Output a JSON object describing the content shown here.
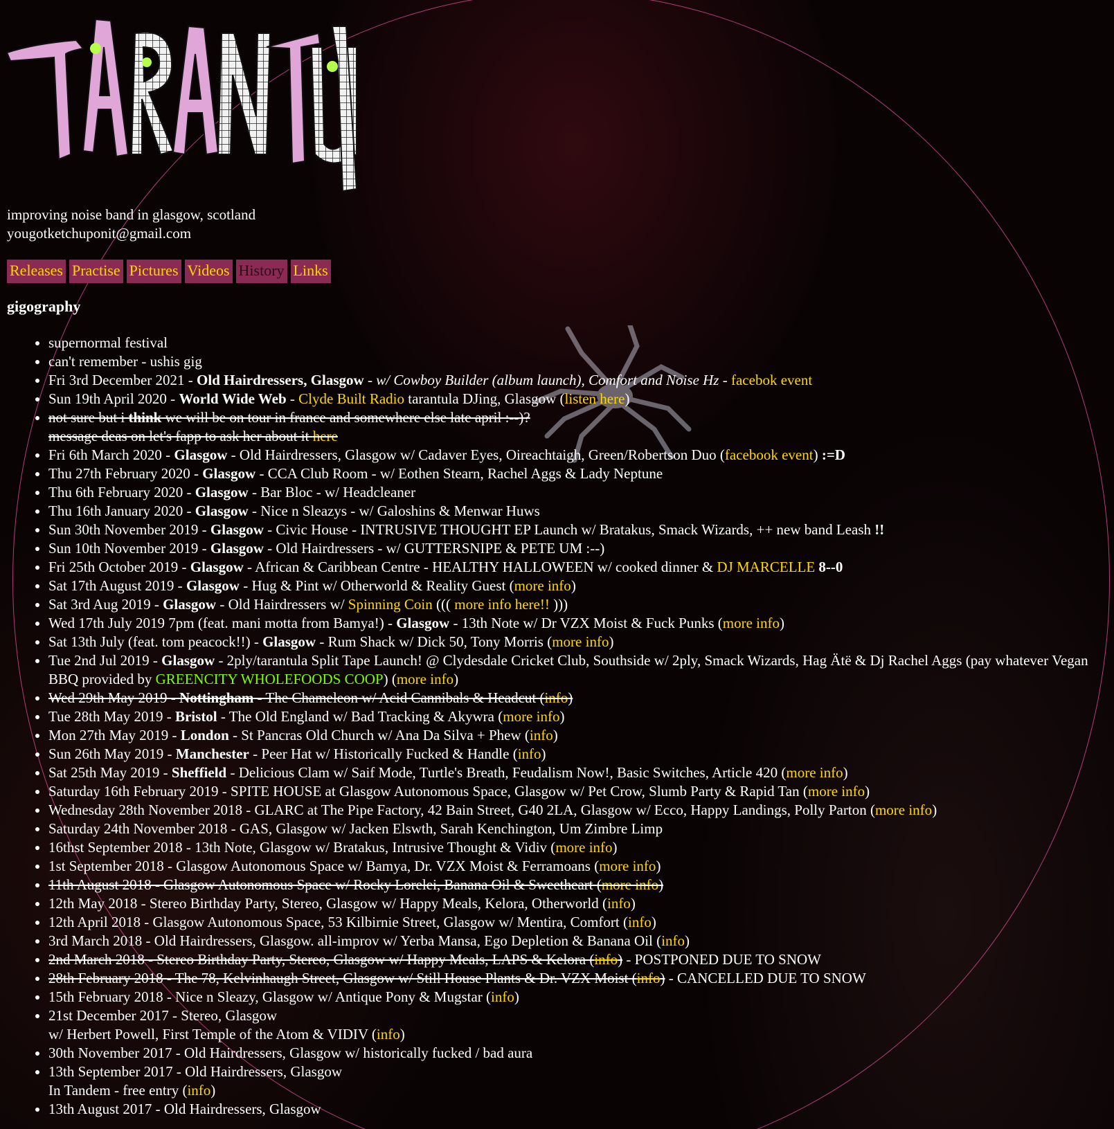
{
  "brand": {
    "logo_text": "TARANTULA",
    "tagline": "improving noise band in glasgow, scotland",
    "email": "yougotketchuponit@gmail.com"
  },
  "nav": [
    {
      "label": "Releases",
      "active": false
    },
    {
      "label": "Practise",
      "active": false
    },
    {
      "label": "Pictures",
      "active": false
    },
    {
      "label": "Videos",
      "active": false
    },
    {
      "label": "History",
      "active": true
    },
    {
      "label": "Links",
      "active": false
    }
  ],
  "section": {
    "title": "gigography"
  },
  "colors": {
    "link": "#ffd700",
    "link_green": "#7cfc00",
    "nav_bg": "#8b2a52",
    "circle": "#b43c78"
  },
  "gigs": [
    {
      "segments": [
        {
          "t": "supernormal festival"
        }
      ]
    },
    {
      "segments": [
        {
          "t": "can't remember - ushis gig"
        }
      ]
    },
    {
      "segments": [
        {
          "t": "Fri 3rd December 2021 - "
        },
        {
          "t": "Old Hairdressers, Glasgow",
          "b": true
        },
        {
          "t": " - "
        },
        {
          "t": "w/ Cowboy Builder (album launch), Comfort and Noise Hz",
          "i": true
        },
        {
          "t": " - "
        },
        {
          "t": "facebok event",
          "link": true
        }
      ]
    },
    {
      "segments": [
        {
          "t": "Sun 19th April 2020 - "
        },
        {
          "t": "World Wide Web",
          "b": true
        },
        {
          "t": " - "
        },
        {
          "t": "Clyde Built Radio",
          "link": true
        },
        {
          "t": " tarantula DJing, Glasgow ("
        },
        {
          "t": "listen here",
          "link": true
        },
        {
          "t": ")"
        }
      ]
    },
    {
      "strike": true,
      "segments": [
        {
          "t": "not sure but i "
        },
        {
          "t": "think",
          "b": true
        },
        {
          "t": " we will be on tour in france and somewhere else late april :--)?"
        },
        {
          "br": true
        },
        {
          "t": "message deas on let's fapp to ask her about it "
        },
        {
          "t": "here",
          "link": true
        }
      ]
    },
    {
      "segments": [
        {
          "t": "Fri 6th March 2020 - "
        },
        {
          "t": "Glasgow",
          "b": true
        },
        {
          "t": " - Old Hairdressers, Glasgow w/ Cadaver Eyes, Oireachtaigh, Green/Robertson Duo ("
        },
        {
          "t": "facebook event",
          "link": true
        },
        {
          "t": ") "
        },
        {
          "t": ":=D",
          "b": true
        }
      ]
    },
    {
      "segments": [
        {
          "t": "Thu 27th February 2020 - "
        },
        {
          "t": "Glasgow",
          "b": true
        },
        {
          "t": " - CCA Club Room - w/ Eothen Stearn, Rachel Aggs & Lady Neptune"
        }
      ]
    },
    {
      "segments": [
        {
          "t": "Thu 6th February 2020 - "
        },
        {
          "t": "Glasgow",
          "b": true
        },
        {
          "t": " - Bar Bloc - w/ Headcleaner"
        }
      ]
    },
    {
      "segments": [
        {
          "t": "Thu 16th January 2020 - "
        },
        {
          "t": "Glasgow",
          "b": true
        },
        {
          "t": " - Nice n Sleazys - w/ Galoshins & Menwar Huws"
        }
      ]
    },
    {
      "segments": [
        {
          "t": "Sun 30th November 2019 - "
        },
        {
          "t": "Glasgow",
          "b": true
        },
        {
          "t": " - Civic House - INTRUSIVE THOUGHT EP Launch w/ Bratakus, Smack Wizards, ++ new band Leash "
        },
        {
          "t": "!!",
          "b": true
        }
      ]
    },
    {
      "segments": [
        {
          "t": "Sun 10th November 2019 - "
        },
        {
          "t": "Glasgow",
          "b": true
        },
        {
          "t": " - Old Hairdressers - w/ GUTTERSNIPE & PETE UM :--)"
        }
      ]
    },
    {
      "segments": [
        {
          "t": "Fri 25th October 2019 - "
        },
        {
          "t": "Glasgow",
          "b": true
        },
        {
          "t": " - African & Caribbean Centre - HEALTHY HALLOWEEN w/ cooked dinner & "
        },
        {
          "t": "DJ MARCELLE",
          "link": true
        },
        {
          "t": " "
        },
        {
          "t": "8--0",
          "b": true
        }
      ]
    },
    {
      "segments": [
        {
          "t": "Sat 17th August 2019 - "
        },
        {
          "t": "Glasgow",
          "b": true
        },
        {
          "t": " - Hug & Pint w/ Otherworld & Reality Guest ("
        },
        {
          "t": "more info",
          "link": true
        },
        {
          "t": ")"
        }
      ]
    },
    {
      "segments": [
        {
          "t": "Sat 3rd Aug 2019 - "
        },
        {
          "t": "Glasgow",
          "b": true
        },
        {
          "t": " - Old Hairdressers w/ "
        },
        {
          "t": "Spinning Coin",
          "link": true
        },
        {
          "t": " ((( "
        },
        {
          "t": "more info here!!",
          "link": true
        },
        {
          "t": " )))"
        }
      ]
    },
    {
      "segments": [
        {
          "t": "Wed 17th July 2019 7pm (feat. mani motta from Bamya!) - "
        },
        {
          "t": "Glasgow",
          "b": true
        },
        {
          "t": " - 13th Note w/ Dr VZX Moist & Fuck Punks ("
        },
        {
          "t": "more info",
          "link": true
        },
        {
          "t": ")"
        }
      ]
    },
    {
      "segments": [
        {
          "t": "Sat 13th July (feat. tom peacock!!) - "
        },
        {
          "t": "Glasgow",
          "b": true
        },
        {
          "t": " - Rum Shack w/ Dick 50, Tony Morris ("
        },
        {
          "t": "more info",
          "link": true
        },
        {
          "t": ")"
        }
      ]
    },
    {
      "segments": [
        {
          "t": "Tue 2nd Jul 2019 - "
        },
        {
          "t": "Glasgow",
          "b": true
        },
        {
          "t": " - 2ply/tarantula Split Tape Launch! @ Clydesdale Cricket Club, Southside w/ 2ply, Smack Wizards, Hag Ätë & Dj Rachel Aggs (pay whatever Vegan BBQ provided by "
        },
        {
          "t": "GREENCITY WHOLEFOODS COOP",
          "green": true
        },
        {
          "t": ") ("
        },
        {
          "t": "more info",
          "link": true
        },
        {
          "t": ")"
        }
      ]
    },
    {
      "strike": true,
      "segments": [
        {
          "t": "Wed 29th May 2019 - "
        },
        {
          "t": "Nottingham",
          "b": true
        },
        {
          "t": " - The Chameleon w/ Acid Cannibals & Headcut ("
        },
        {
          "t": "info",
          "link": true
        },
        {
          "t": ")"
        }
      ]
    },
    {
      "segments": [
        {
          "t": "Tue 28th May 2019 - "
        },
        {
          "t": "Bristol",
          "b": true
        },
        {
          "t": " - The Old England w/ Bad Tracking & Akywra ("
        },
        {
          "t": "more info",
          "link": true
        },
        {
          "t": ")"
        }
      ]
    },
    {
      "segments": [
        {
          "t": "Mon 27th May 2019 - "
        },
        {
          "t": "London",
          "b": true
        },
        {
          "t": " - St Pancras Old Church w/ Ana Da Silva + Phew ("
        },
        {
          "t": "info",
          "link": true
        },
        {
          "t": ")"
        }
      ]
    },
    {
      "segments": [
        {
          "t": "Sun 26th May 2019 - "
        },
        {
          "t": "Manchester",
          "b": true
        },
        {
          "t": " - Peer Hat w/ Historically Fucked & Handle ("
        },
        {
          "t": "info",
          "link": true
        },
        {
          "t": ")"
        }
      ]
    },
    {
      "segments": [
        {
          "t": "Sat 25th May 2019 - "
        },
        {
          "t": "Sheffield",
          "b": true
        },
        {
          "t": " - Delicious Clam w/ Saif Mode, Turtle's Breath, Feudalism Now!, Basic Switches, Article 420 ("
        },
        {
          "t": "more info",
          "link": true
        },
        {
          "t": ")"
        }
      ]
    },
    {
      "segments": [
        {
          "t": "Saturday 16th February 2019 - SPITE HOUSE at Glasgow Autonomous Space, Glasgow w/ Pet Crow, Slumb Party & Rapid Tan ("
        },
        {
          "t": "more info",
          "link": true
        },
        {
          "t": ")"
        }
      ]
    },
    {
      "segments": [
        {
          "t": "Wednesday 28th November 2018 - GLARC at The Pipe Factory, 42 Bain Street, G40 2LA, Glasgow w/ Ecco, Happy Landings, Polly Parton ("
        },
        {
          "t": "more info",
          "link": true
        },
        {
          "t": ")"
        }
      ]
    },
    {
      "segments": [
        {
          "t": "Saturday 24th November 2018 - GAS, Glasgow w/ Jacken Elswth, Sarah Kenchington, Um Zimbre Limp"
        }
      ]
    },
    {
      "segments": [
        {
          "t": "16thst September 2018 - 13th Note, Glasgow w/ Bratakus, Intrusive Thought & Vidiv ("
        },
        {
          "t": "more info",
          "link": true
        },
        {
          "t": ")"
        }
      ]
    },
    {
      "segments": [
        {
          "t": "1st September 2018 - Glasgow Autonomous Space w/ Bamya, Dr. VZX Moist & Ferramoans ("
        },
        {
          "t": "more info",
          "link": true
        },
        {
          "t": ")"
        }
      ]
    },
    {
      "strike": true,
      "segments": [
        {
          "t": "11th August 2018 - Glasgow Autonomous Space w/ Rocky Lorelei, Banana Oil & Sweetheart ("
        },
        {
          "t": "more info",
          "link": true
        },
        {
          "t": ")"
        }
      ]
    },
    {
      "segments": [
        {
          "t": "12th May 2018 - Stereo Birthday Party, Stereo, Glasgow w/ Happy Meals, Kelora, Otherworld ("
        },
        {
          "t": "info",
          "link": true
        },
        {
          "t": ")"
        }
      ]
    },
    {
      "segments": [
        {
          "t": "12th April 2018 - Glasgow Autonomous Space, 53 Kilbirnie Street, Glasgow w/ Mentira, Comfort ("
        },
        {
          "t": "info",
          "link": true
        },
        {
          "t": ")"
        }
      ]
    },
    {
      "segments": [
        {
          "t": "3rd March 2018 - Old Hairdressers, Glasgow. all-improv w/ Yerba Mansa, Ego Depletion & Banana Oil ("
        },
        {
          "t": "info",
          "link": true
        },
        {
          "t": ")"
        }
      ]
    },
    {
      "segments": [
        {
          "t": "2nd March 2018 - Stereo Birthday Party, Stereo, Glasgow w/ Happy Meals, LAPS & Kelora (",
          "s": true
        },
        {
          "t": "info",
          "link": true,
          "s": true
        },
        {
          "t": ")",
          "s": true
        },
        {
          "t": " - POSTPONED DUE TO SNOW"
        }
      ]
    },
    {
      "segments": [
        {
          "t": "28th February 2018 - The 78, Kelvinhaugh Street, Glasgow w/ Still House Plants & Dr. VZX Moist (",
          "s": true
        },
        {
          "t": "info",
          "link": true,
          "s": true
        },
        {
          "t": ")",
          "s": true
        },
        {
          "t": " - CANCELLED DUE TO SNOW"
        }
      ]
    },
    {
      "segments": [
        {
          "t": "15th February 2018 - Nice n Sleazy, Glasgow w/ Antique Pony & Mugstar ("
        },
        {
          "t": "info",
          "link": true
        },
        {
          "t": ")"
        }
      ]
    },
    {
      "segments": [
        {
          "t": "21st December 2017 - Stereo, Glasgow"
        },
        {
          "br": true
        },
        {
          "t": "w/ Herbert Powell, First Temple of the Atom & VIDIV ("
        },
        {
          "t": "info",
          "link": true
        },
        {
          "t": ")"
        }
      ]
    },
    {
      "segments": [
        {
          "t": "30th November 2017 - Old Hairdressers, Glasgow w/ historically fucked / bad aura"
        }
      ]
    },
    {
      "segments": [
        {
          "t": "13th September 2017 - Old Hairdressers, Glasgow"
        },
        {
          "br": true
        },
        {
          "t": "In Tandem - free entry ("
        },
        {
          "t": "info",
          "link": true
        },
        {
          "t": ")"
        }
      ]
    },
    {
      "segments": [
        {
          "t": "13th August 2017 - Old Hairdressers, Glasgow"
        }
      ]
    }
  ]
}
